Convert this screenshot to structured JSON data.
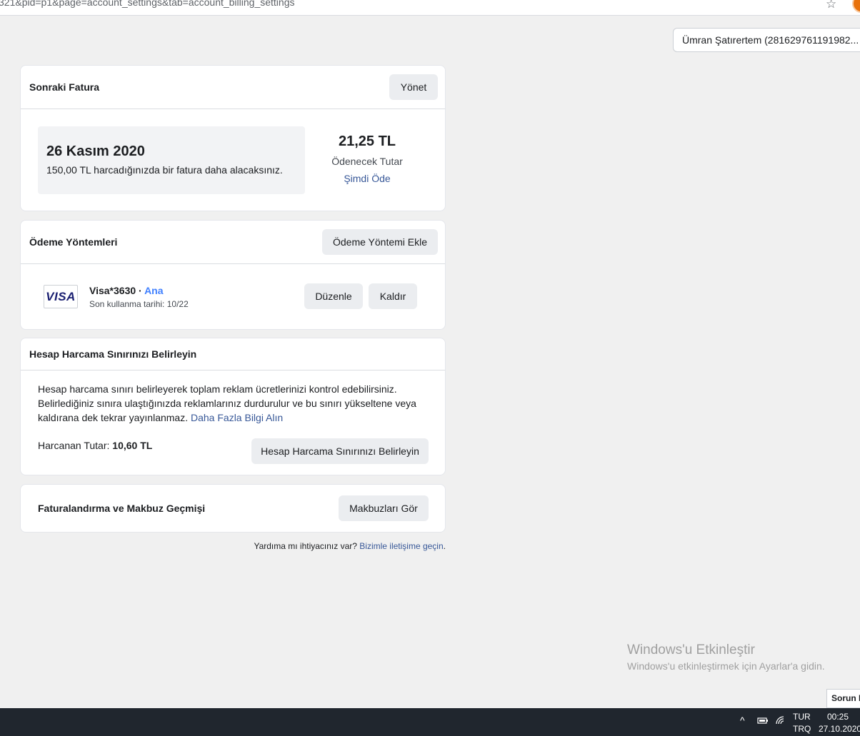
{
  "browser": {
    "url": "321&pid=p1&page=account_settings&tab=account_billing_settings",
    "bookmark_icon": "star-icon"
  },
  "account": {
    "selector": "Ümran Şatırertem (281629761191982..."
  },
  "next_invoice": {
    "title": "Sonraki Fatura",
    "manage_button": "Yönet",
    "date": "26 Kasım 2020",
    "note": "150,00 TL harcadığınızda bir fatura daha alacaksınız.",
    "amount": "21,25 TL",
    "amount_label": "Ödenecek Tutar",
    "pay_now": "Şimdi Öde"
  },
  "payment_methods": {
    "title": "Ödeme Yöntemleri",
    "add_button": "Ödeme Yöntemi Ekle",
    "card": {
      "brand": "VISA",
      "name": "Visa*3630 · ",
      "primary": "Ana",
      "expiry": "Son kullanma tarihi: 10/22"
    },
    "edit_button": "Düzenle",
    "remove_button": "Kaldır"
  },
  "spending_limit": {
    "title": "Hesap Harcama Sınırınızı Belirleyin",
    "description": "Hesap harcama sınırı belirleyerek toplam reklam ücretlerinizi kontrol edebilirsiniz. Belirlediğiniz sınıra ulaştığınızda reklamlarınız durdurulur ve bu sınırı yükseltene veya kaldırana dek tekrar yayınlanmaz. ",
    "learn_more": "Daha Fazla Bilgi Alın",
    "spent_label": "Harcanan Tutar: ",
    "spent_value": "10,60 TL",
    "set_button": "Hesap Harcama Sınırınızı Belirleyin"
  },
  "history": {
    "title": "Faturalandırma ve Makbuz Geçmişi",
    "view_button": "Makbuzları Gör"
  },
  "help": {
    "text": "Yardıma mı ihtiyacınız var? ",
    "link": "Bizimle iletişime geçin",
    "suffix": "."
  },
  "watermark": {
    "title": "Windows'u Etkinleştir",
    "subtitle": "Windows'u etkinleştirmek için Ayarlar'a gidin."
  },
  "feedback_button": "Sorun Bildir",
  "taskbar": {
    "lang_1": "TUR",
    "lang_2": "TRQ",
    "time": "00:25",
    "date": "27.10.2020"
  }
}
